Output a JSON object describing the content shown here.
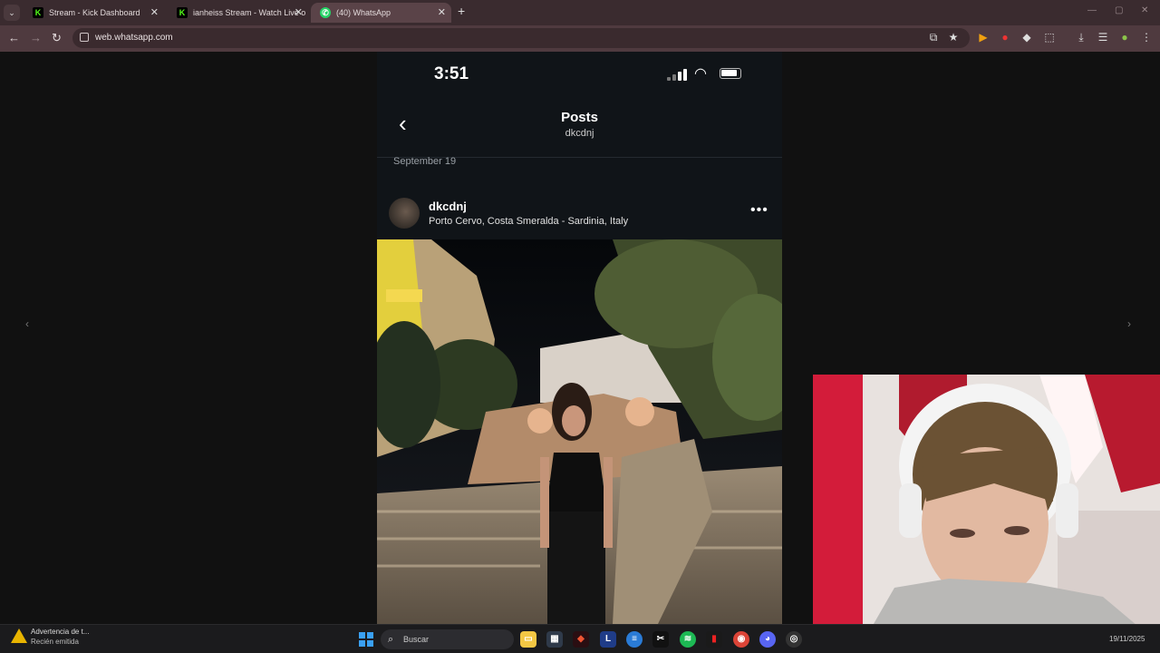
{
  "browser": {
    "tabs": [
      {
        "title": "Stream - Kick Dashboard",
        "active": false
      },
      {
        "title": "ianheiss Stream - Watch Live o",
        "active": false
      },
      {
        "title": "(40) WhatsApp",
        "active": true
      }
    ],
    "url": "web.whatsapp.com",
    "accent": "#4f3a3f"
  },
  "phone": {
    "status_time": "3:51",
    "header_title": "Posts",
    "header_subtitle": "dkcdnj",
    "date_label": "September 19",
    "post": {
      "username": "dkcdnj",
      "location": "Porto Cervo, Costa Smeralda - Sardinia, Italy",
      "more_icon": "ellipsis-icon"
    }
  },
  "taskbar": {
    "notification_title": "Advertencia de t...",
    "notification_subtitle": "Recién emitida",
    "search_placeholder": "Buscar",
    "date": "19/11/2025"
  }
}
